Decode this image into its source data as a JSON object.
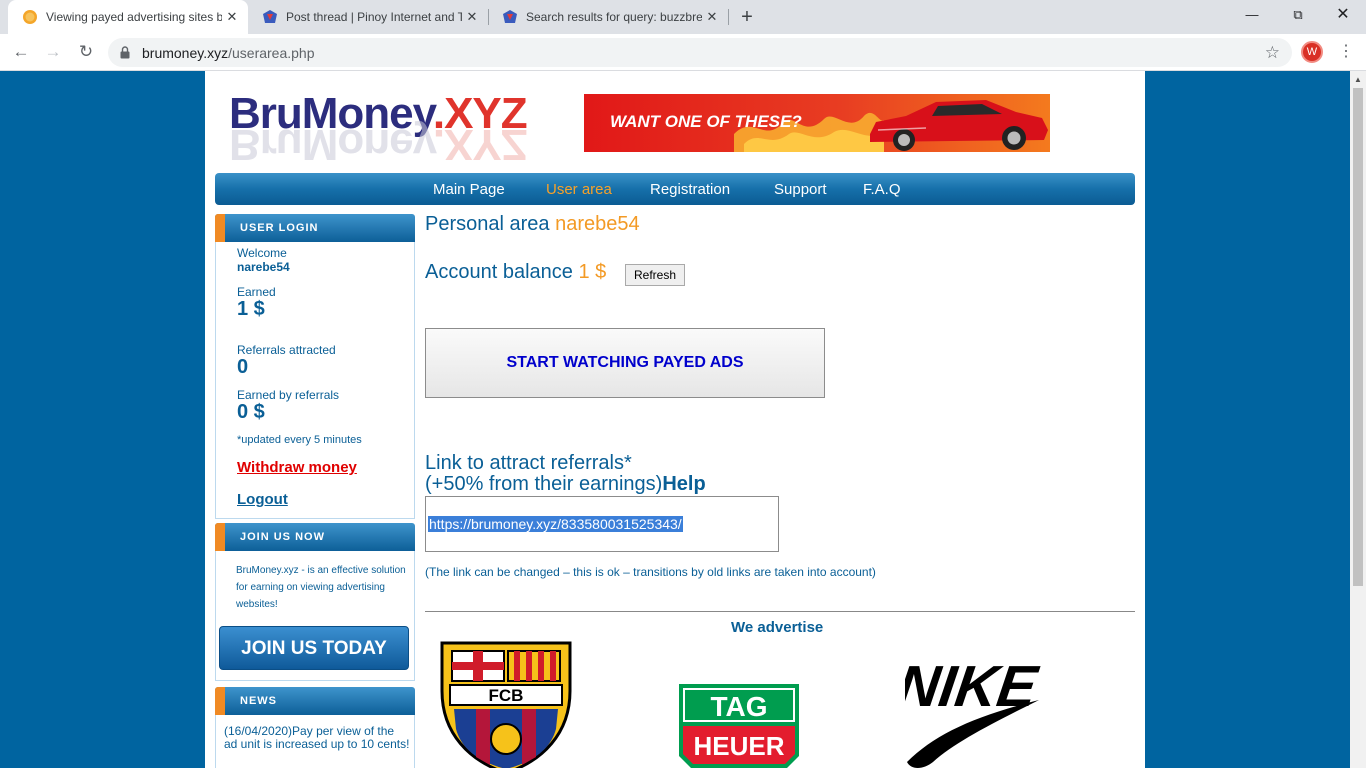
{
  "browser": {
    "tabs": [
      {
        "title": "Viewing payed advertising sites b",
        "active": true
      },
      {
        "title": "Post thread | Pinoy Internet and T",
        "active": false
      },
      {
        "title": "Search results for query: buzzbrea",
        "active": false
      }
    ],
    "url_host": "brumoney.xyz",
    "url_path": "/userarea.php",
    "profile_initial": "W"
  },
  "site": {
    "logo_main": "BruMoney",
    "logo_ext": ".XYZ",
    "banner_text": "WANT ONE OF THESE?",
    "nav": [
      {
        "label": "Main Page",
        "current": false
      },
      {
        "label": "User area",
        "current": true
      },
      {
        "label": "Registration",
        "current": false
      },
      {
        "label": "Support",
        "current": false
      },
      {
        "label": "F.A.Q",
        "current": false
      }
    ]
  },
  "sidebar": {
    "login": {
      "heading": "USER LOGIN",
      "welcome_label": "Welcome",
      "username": "narebe54",
      "earned_label": "Earned",
      "earned_value": "1 $",
      "referrals_label": "Referrals attracted",
      "referrals_value": "0",
      "earned_ref_label": "Earned by referrals",
      "earned_ref_value": "0 $",
      "update_note": "*updated every 5 minutes",
      "withdraw": "Withdraw money",
      "logout": "Logout"
    },
    "join": {
      "heading": "JOIN US NOW",
      "description": "BruMoney.xyz - is an effective solution for earning on viewing advertising websites!",
      "button": "JOIN US TODAY"
    },
    "news": {
      "heading": "NEWS",
      "text": "(16/04/2020)Pay per view of the ad unit is increased up to 10 cents!"
    }
  },
  "main": {
    "personal_label": "Personal area",
    "username": "narebe54",
    "balance_label": "Account balance",
    "balance_value": "1 $",
    "refresh_button": "Refresh",
    "start_button": "START WATCHING PAYED ADS",
    "ref_title_line1": "Link to attract referrals*",
    "ref_title_line2": "(+50% from their earnings)",
    "help_link": "Help",
    "ref_link": "https://brumoney.xyz/833580031525343/",
    "ref_note": "(The link can be changed – this is ok – transitions by old links are taken into account)",
    "advertise_title": "We advertise",
    "brands": {
      "fcb_text": "FCB",
      "tag_text": "TAG",
      "heuer_text": "HEUER",
      "nike_text": "NIKE"
    }
  },
  "colors": {
    "page_bg": "#0064a0",
    "text_blue": "#0a5f96",
    "accent_orange": "#f39a25",
    "withdraw_red": "#e00000"
  }
}
